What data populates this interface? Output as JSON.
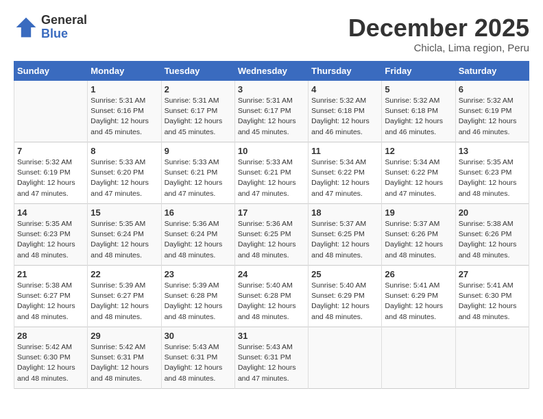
{
  "header": {
    "logo": {
      "general": "General",
      "blue": "Blue"
    },
    "title": "December 2025",
    "location": "Chicla, Lima region, Peru"
  },
  "days_of_week": [
    "Sunday",
    "Monday",
    "Tuesday",
    "Wednesday",
    "Thursday",
    "Friday",
    "Saturday"
  ],
  "weeks": [
    [
      {
        "day": "",
        "sunrise": "",
        "sunset": "",
        "daylight": ""
      },
      {
        "day": "1",
        "sunrise": "Sunrise: 5:31 AM",
        "sunset": "Sunset: 6:16 PM",
        "daylight": "Daylight: 12 hours and 45 minutes."
      },
      {
        "day": "2",
        "sunrise": "Sunrise: 5:31 AM",
        "sunset": "Sunset: 6:17 PM",
        "daylight": "Daylight: 12 hours and 45 minutes."
      },
      {
        "day": "3",
        "sunrise": "Sunrise: 5:31 AM",
        "sunset": "Sunset: 6:17 PM",
        "daylight": "Daylight: 12 hours and 45 minutes."
      },
      {
        "day": "4",
        "sunrise": "Sunrise: 5:32 AM",
        "sunset": "Sunset: 6:18 PM",
        "daylight": "Daylight: 12 hours and 46 minutes."
      },
      {
        "day": "5",
        "sunrise": "Sunrise: 5:32 AM",
        "sunset": "Sunset: 6:18 PM",
        "daylight": "Daylight: 12 hours and 46 minutes."
      },
      {
        "day": "6",
        "sunrise": "Sunrise: 5:32 AM",
        "sunset": "Sunset: 6:19 PM",
        "daylight": "Daylight: 12 hours and 46 minutes."
      }
    ],
    [
      {
        "day": "7",
        "sunrise": "Sunrise: 5:32 AM",
        "sunset": "Sunset: 6:19 PM",
        "daylight": "Daylight: 12 hours and 47 minutes."
      },
      {
        "day": "8",
        "sunrise": "Sunrise: 5:33 AM",
        "sunset": "Sunset: 6:20 PM",
        "daylight": "Daylight: 12 hours and 47 minutes."
      },
      {
        "day": "9",
        "sunrise": "Sunrise: 5:33 AM",
        "sunset": "Sunset: 6:21 PM",
        "daylight": "Daylight: 12 hours and 47 minutes."
      },
      {
        "day": "10",
        "sunrise": "Sunrise: 5:33 AM",
        "sunset": "Sunset: 6:21 PM",
        "daylight": "Daylight: 12 hours and 47 minutes."
      },
      {
        "day": "11",
        "sunrise": "Sunrise: 5:34 AM",
        "sunset": "Sunset: 6:22 PM",
        "daylight": "Daylight: 12 hours and 47 minutes."
      },
      {
        "day": "12",
        "sunrise": "Sunrise: 5:34 AM",
        "sunset": "Sunset: 6:22 PM",
        "daylight": "Daylight: 12 hours and 47 minutes."
      },
      {
        "day": "13",
        "sunrise": "Sunrise: 5:35 AM",
        "sunset": "Sunset: 6:23 PM",
        "daylight": "Daylight: 12 hours and 48 minutes."
      }
    ],
    [
      {
        "day": "14",
        "sunrise": "Sunrise: 5:35 AM",
        "sunset": "Sunset: 6:23 PM",
        "daylight": "Daylight: 12 hours and 48 minutes."
      },
      {
        "day": "15",
        "sunrise": "Sunrise: 5:35 AM",
        "sunset": "Sunset: 6:24 PM",
        "daylight": "Daylight: 12 hours and 48 minutes."
      },
      {
        "day": "16",
        "sunrise": "Sunrise: 5:36 AM",
        "sunset": "Sunset: 6:24 PM",
        "daylight": "Daylight: 12 hours and 48 minutes."
      },
      {
        "day": "17",
        "sunrise": "Sunrise: 5:36 AM",
        "sunset": "Sunset: 6:25 PM",
        "daylight": "Daylight: 12 hours and 48 minutes."
      },
      {
        "day": "18",
        "sunrise": "Sunrise: 5:37 AM",
        "sunset": "Sunset: 6:25 PM",
        "daylight": "Daylight: 12 hours and 48 minutes."
      },
      {
        "day": "19",
        "sunrise": "Sunrise: 5:37 AM",
        "sunset": "Sunset: 6:26 PM",
        "daylight": "Daylight: 12 hours and 48 minutes."
      },
      {
        "day": "20",
        "sunrise": "Sunrise: 5:38 AM",
        "sunset": "Sunset: 6:26 PM",
        "daylight": "Daylight: 12 hours and 48 minutes."
      }
    ],
    [
      {
        "day": "21",
        "sunrise": "Sunrise: 5:38 AM",
        "sunset": "Sunset: 6:27 PM",
        "daylight": "Daylight: 12 hours and 48 minutes."
      },
      {
        "day": "22",
        "sunrise": "Sunrise: 5:39 AM",
        "sunset": "Sunset: 6:27 PM",
        "daylight": "Daylight: 12 hours and 48 minutes."
      },
      {
        "day": "23",
        "sunrise": "Sunrise: 5:39 AM",
        "sunset": "Sunset: 6:28 PM",
        "daylight": "Daylight: 12 hours and 48 minutes."
      },
      {
        "day": "24",
        "sunrise": "Sunrise: 5:40 AM",
        "sunset": "Sunset: 6:28 PM",
        "daylight": "Daylight: 12 hours and 48 minutes."
      },
      {
        "day": "25",
        "sunrise": "Sunrise: 5:40 AM",
        "sunset": "Sunset: 6:29 PM",
        "daylight": "Daylight: 12 hours and 48 minutes."
      },
      {
        "day": "26",
        "sunrise": "Sunrise: 5:41 AM",
        "sunset": "Sunset: 6:29 PM",
        "daylight": "Daylight: 12 hours and 48 minutes."
      },
      {
        "day": "27",
        "sunrise": "Sunrise: 5:41 AM",
        "sunset": "Sunset: 6:30 PM",
        "daylight": "Daylight: 12 hours and 48 minutes."
      }
    ],
    [
      {
        "day": "28",
        "sunrise": "Sunrise: 5:42 AM",
        "sunset": "Sunset: 6:30 PM",
        "daylight": "Daylight: 12 hours and 48 minutes."
      },
      {
        "day": "29",
        "sunrise": "Sunrise: 5:42 AM",
        "sunset": "Sunset: 6:31 PM",
        "daylight": "Daylight: 12 hours and 48 minutes."
      },
      {
        "day": "30",
        "sunrise": "Sunrise: 5:43 AM",
        "sunset": "Sunset: 6:31 PM",
        "daylight": "Daylight: 12 hours and 48 minutes."
      },
      {
        "day": "31",
        "sunrise": "Sunrise: 5:43 AM",
        "sunset": "Sunset: 6:31 PM",
        "daylight": "Daylight: 12 hours and 47 minutes."
      },
      {
        "day": "",
        "sunrise": "",
        "sunset": "",
        "daylight": ""
      },
      {
        "day": "",
        "sunrise": "",
        "sunset": "",
        "daylight": ""
      },
      {
        "day": "",
        "sunrise": "",
        "sunset": "",
        "daylight": ""
      }
    ]
  ]
}
